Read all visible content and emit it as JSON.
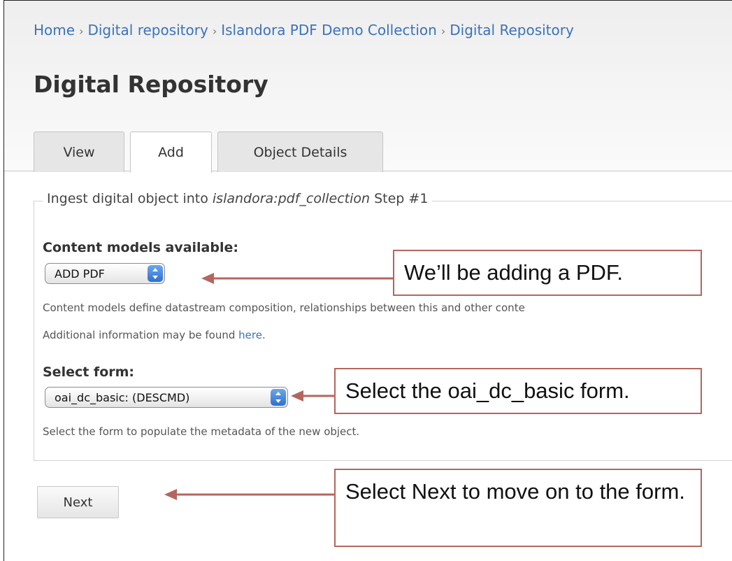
{
  "breadcrumb": {
    "items": [
      "Home",
      "Digital repository",
      "Islandora PDF Demo Collection",
      "Digital Repository"
    ],
    "separator": "›"
  },
  "page": {
    "title": "Digital Repository"
  },
  "tabs": [
    {
      "label": "View",
      "active": false
    },
    {
      "label": "Add",
      "active": true
    },
    {
      "label": "Object Details",
      "active": false
    }
  ],
  "form": {
    "legend_prefix": "Ingest digital object into ",
    "legend_collection": "islandora:pdf_collection",
    "legend_suffix": " Step #1",
    "content_models": {
      "label": "Content models available:",
      "selected": "ADD PDF",
      "help_line1": "Content models define datastream composition, relationships between this and other conte",
      "help_line2_prefix": "Additional information may be found ",
      "help_link": "here",
      "help_line2_suffix": "."
    },
    "select_form": {
      "label": "Select form:",
      "selected": "oai_dc_basic: (DESCMD)",
      "help": "Select the form to populate the metadata of the new object."
    },
    "next_label": "Next"
  },
  "annotations": {
    "callout_1": "We’ll be adding a PDF.",
    "callout_2": "Select the oai_dc_basic form.",
    "callout_3": "Select Next to move on to the form.",
    "color": "#b5655f"
  },
  "colors": {
    "link": "#3b73b9",
    "stepper": "#2f6fd0"
  }
}
